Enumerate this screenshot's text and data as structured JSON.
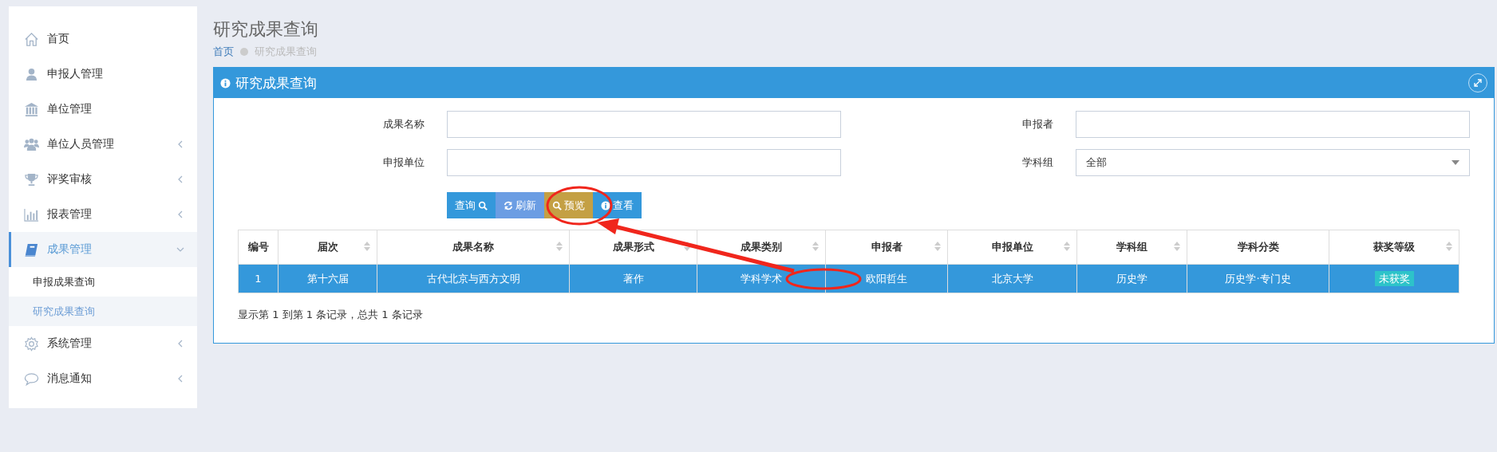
{
  "sidebar": {
    "items": [
      {
        "label": "首页",
        "has_submenu": false,
        "selected": false
      },
      {
        "label": "申报人管理",
        "has_submenu": false,
        "selected": false
      },
      {
        "label": "单位管理",
        "has_submenu": false,
        "selected": false
      },
      {
        "label": "单位人员管理",
        "has_submenu": true,
        "expanded": false,
        "selected": false
      },
      {
        "label": "评奖审核",
        "has_submenu": true,
        "expanded": false,
        "selected": false
      },
      {
        "label": "报表管理",
        "has_submenu": true,
        "expanded": false,
        "selected": false
      },
      {
        "label": "成果管理",
        "has_submenu": true,
        "expanded": true,
        "selected": true,
        "children": [
          {
            "label": "申报成果查询",
            "selected": false
          },
          {
            "label": "研究成果查询",
            "selected": true
          }
        ]
      },
      {
        "label": "系统管理",
        "has_submenu": true,
        "expanded": false,
        "selected": false
      },
      {
        "label": "消息通知",
        "has_submenu": true,
        "expanded": false,
        "selected": false
      }
    ]
  },
  "page": {
    "title": "研究成果查询",
    "breadcrumb": [
      {
        "label": "首页"
      },
      {
        "label": "研究成果查询"
      }
    ]
  },
  "panel": {
    "title": "研究成果查询",
    "form": [
      {
        "label": "成果名称",
        "kind": "text"
      },
      {
        "label": "申报者",
        "kind": "text"
      },
      {
        "label": "申报单位",
        "kind": "text"
      },
      {
        "label": "学科组",
        "kind": "select",
        "value": "全部"
      }
    ],
    "buttons": [
      {
        "label": "查询",
        "kind": "search",
        "icon_after": true
      },
      {
        "label": "刷新",
        "kind": "refresh",
        "icon_after": false
      },
      {
        "label": "预览",
        "kind": "preview",
        "icon_after": false
      },
      {
        "label": "查看",
        "kind": "view",
        "icon_after": false
      }
    ],
    "table": {
      "columns": [
        {
          "label": "编号",
          "sortable": false
        },
        {
          "label": "届次",
          "sortable": true
        },
        {
          "label": "成果名称",
          "sortable": true
        },
        {
          "label": "成果形式",
          "sortable": true
        },
        {
          "label": "成果类别",
          "sortable": true
        },
        {
          "label": "申报者",
          "sortable": true
        },
        {
          "label": "申报单位",
          "sortable": true
        },
        {
          "label": "学科组",
          "sortable": true
        },
        {
          "label": "学科分类",
          "sortable": false
        },
        {
          "label": "获奖等级",
          "sortable": true
        }
      ],
      "rows": [
        {
          "selected": true,
          "cells": [
            "1",
            "第十六届",
            "古代北京与西方文明",
            "著作",
            "学科学术",
            "欧阳哲生",
            "北京大学",
            "历史学",
            "历史学·专门史"
          ],
          "award": "未获奖"
        }
      ]
    },
    "footer": "显示第 1 到第 1 条记录，总共 1 条记录"
  }
}
